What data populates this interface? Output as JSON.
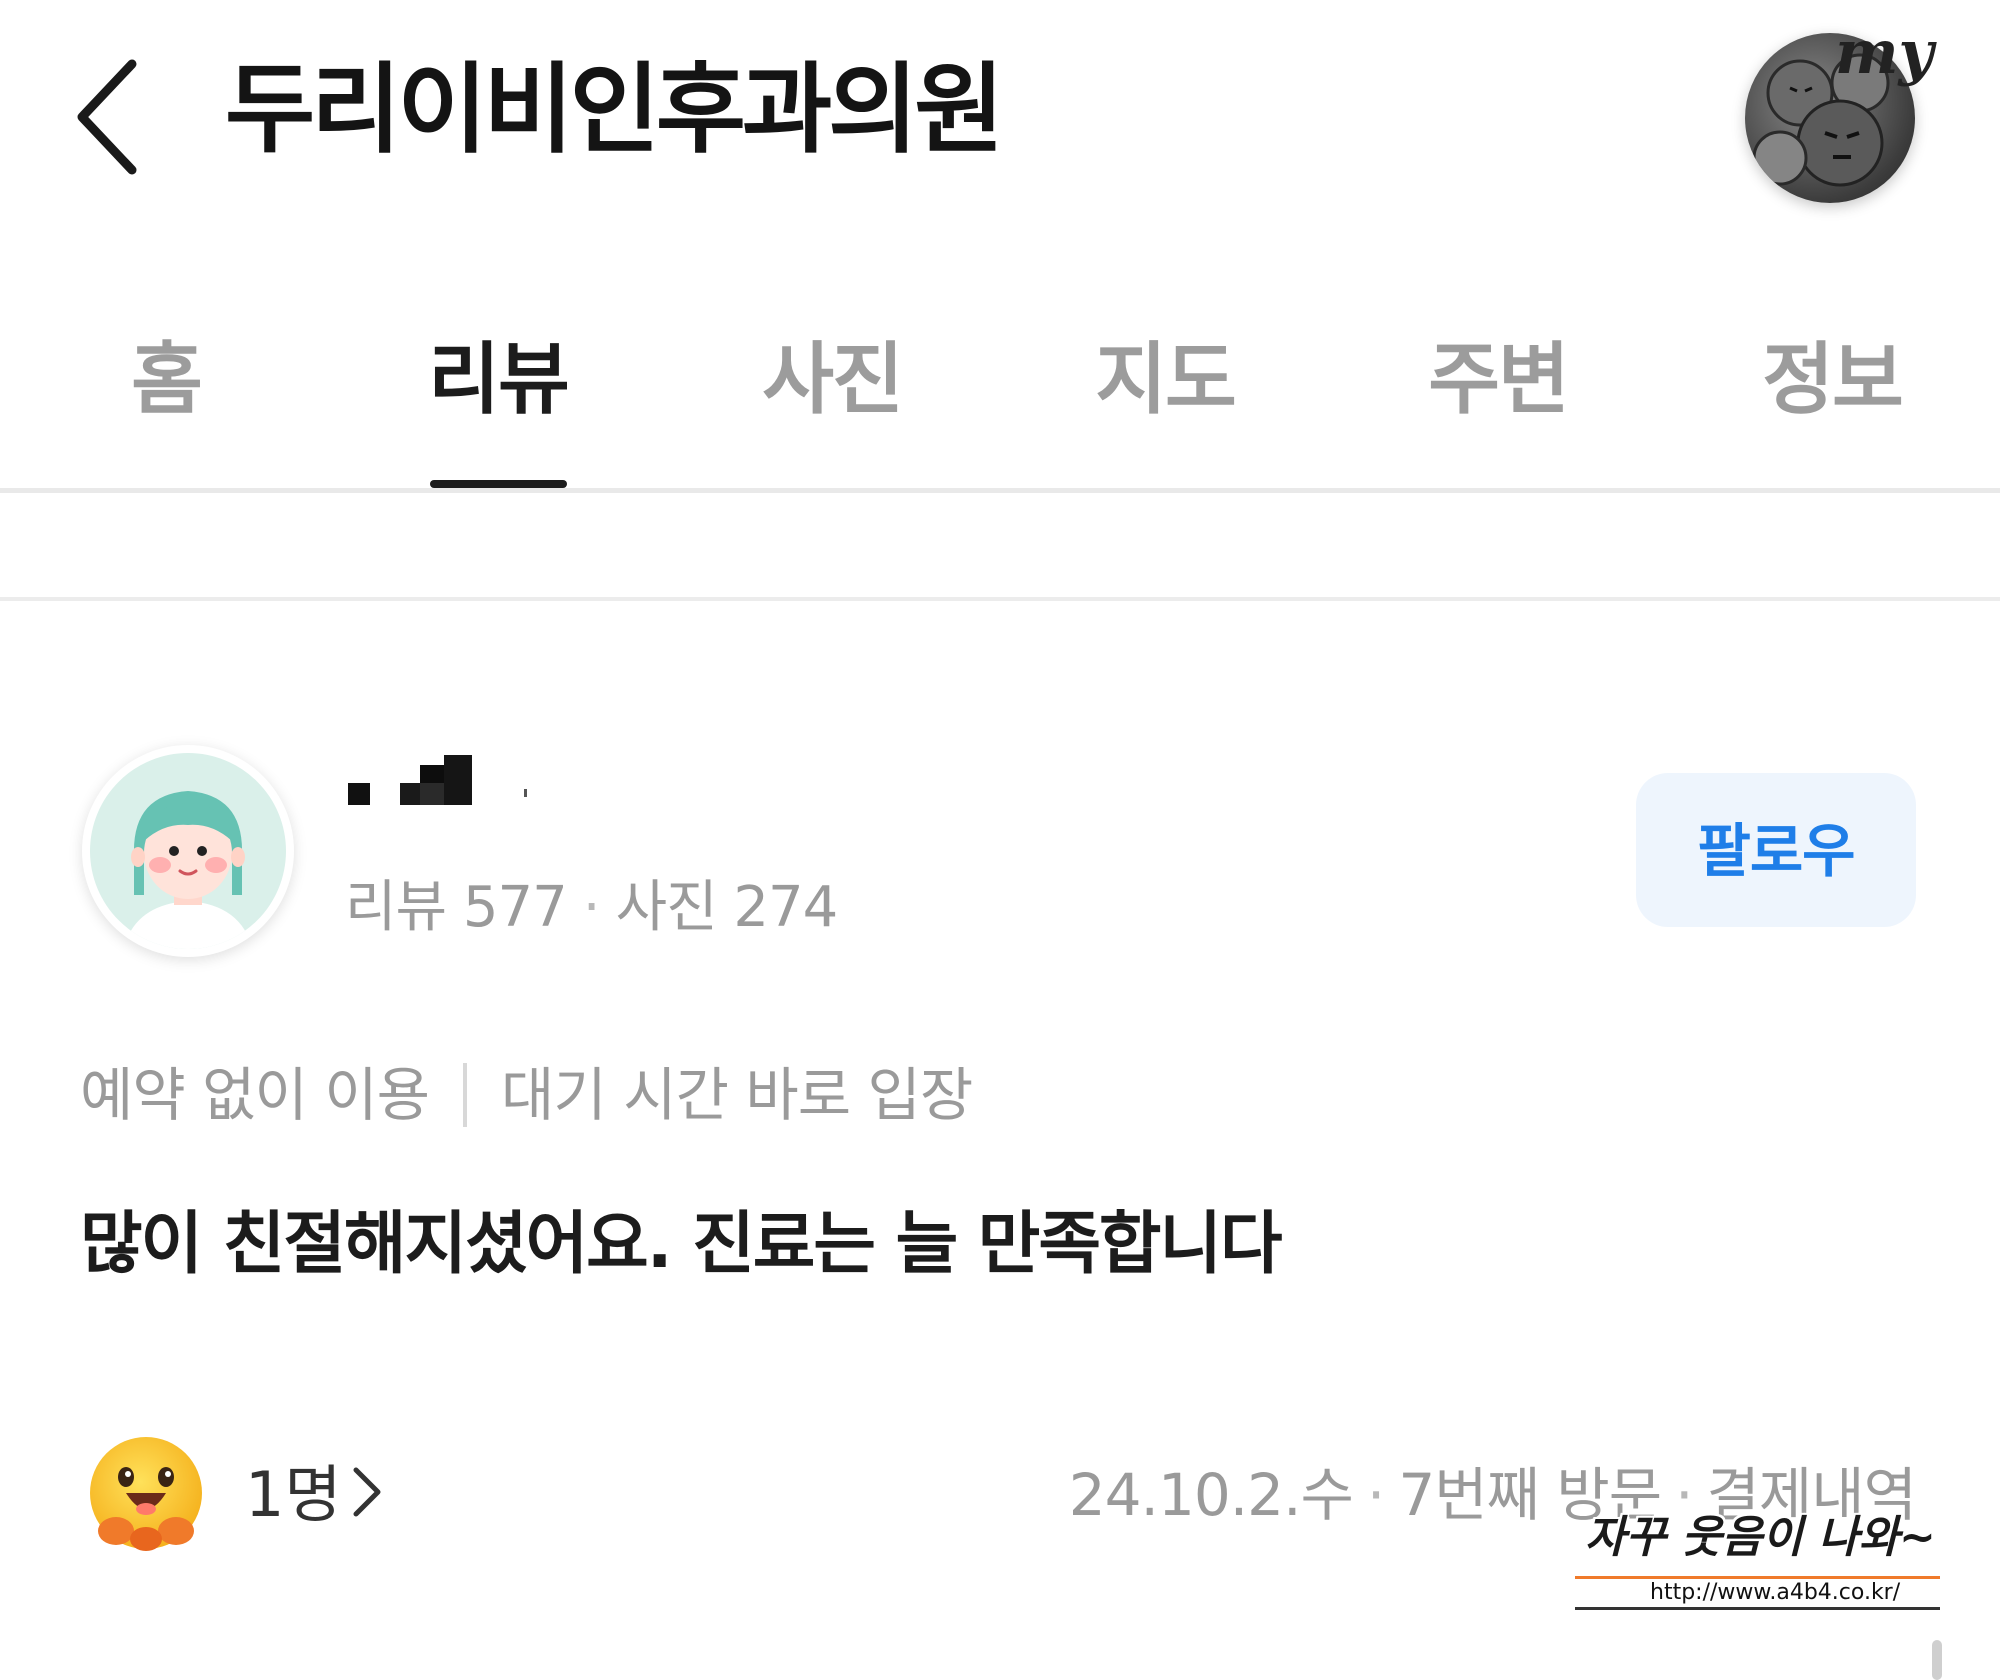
{
  "header": {
    "title": "두리이비인후과의원",
    "back_icon": "chevron-left-icon",
    "my_badge": "my"
  },
  "tabs": [
    {
      "label": "홈",
      "active": false
    },
    {
      "label": "리뷰",
      "active": true
    },
    {
      "label": "사진",
      "active": false
    },
    {
      "label": "지도",
      "active": false
    },
    {
      "label": "주변",
      "active": false
    },
    {
      "label": "정보",
      "active": false
    }
  ],
  "review": {
    "reviewer": {
      "name_redacted": true,
      "stats": {
        "review_label": "리뷰",
        "review_count": "577",
        "photo_label": "사진",
        "photo_count": "274"
      },
      "follow_label": "팔로우"
    },
    "tags": [
      "예약 없이 이용",
      "대기 시간 바로 입장"
    ],
    "text": "많이 친절해지셨어요. 진료는 늘 만족합니다",
    "reaction": {
      "icon": "smiling-face-icon",
      "count_label": "1명"
    },
    "visit": {
      "date": "24.10.2.수",
      "visit_count": "7번째 방문",
      "receipt": "결제내역"
    }
  },
  "watermark": {
    "text": "자꾸 웃음이 나와~",
    "url": "http://www.a4b4.co.kr/"
  },
  "colors": {
    "accent": "#1f7ee8",
    "follow_bg": "#eef5fd",
    "muted_text": "#9a9a9a",
    "active_tab": "#1c1c1c"
  }
}
